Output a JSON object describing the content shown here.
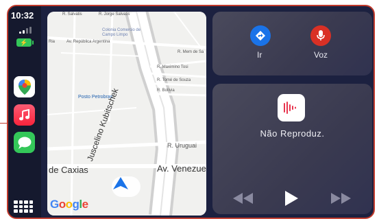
{
  "status": {
    "time": "10:32"
  },
  "map": {
    "labels": {
      "street_top1": "R. Salvatis",
      "street_top2": "R. Jorge Salvatis",
      "place_small": "Colonia Comercio de Campo Limpo",
      "av_republica": "Av. República Argentina",
      "r_mem": "R. Mem de Sá",
      "r_maximino": "R. Maximino Tosi",
      "r_tome": "R. Tomé de Souza",
      "r_bolivia": "R. Bolívia",
      "posto": "Posto Petrobras",
      "r_uruguai": "R. Uruguai",
      "duque": "de Caxias",
      "av_venezuela": "Av. Venezuel",
      "kubitschek": "Juscelino Kubitschek",
      "misc1": "Ria",
      "misc2": "Vra"
    },
    "logo_text": "Google"
  },
  "shortcuts": {
    "go_label": "Ir",
    "voice_label": "Voz"
  },
  "now_playing": {
    "status": "Não Reproduz."
  },
  "colors": {
    "accent_blue": "#1a73e8",
    "accent_red": "#d93025",
    "border": "#c0392b"
  }
}
